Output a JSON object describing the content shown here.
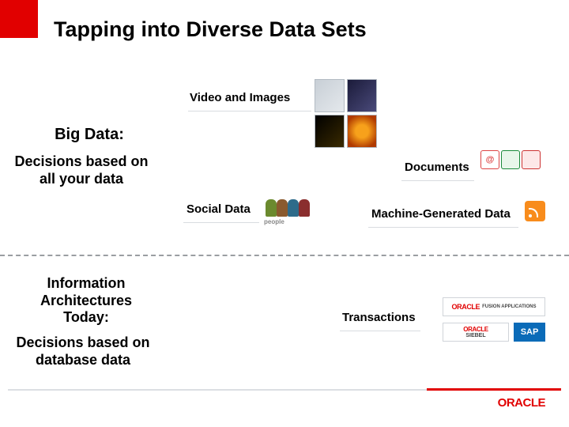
{
  "title": "Tapping into Diverse Data Sets",
  "sections": {
    "bigdata": {
      "heading": "Big Data:",
      "subheading": "Decisions based on all your data"
    },
    "today": {
      "heading": "Information Architectures Today:",
      "subheading": "Decisions based on database data"
    }
  },
  "categories": {
    "video_images": "Video and Images",
    "documents": "Documents",
    "social_data": "Social Data",
    "machine_generated": "Machine-Generated Data",
    "transactions": "Transactions"
  },
  "footer_brand": "ORACLE",
  "vendors": {
    "fusion": "FUSION APPLICATIONS",
    "siebel": "SIEBEL",
    "sap": "SAP"
  }
}
